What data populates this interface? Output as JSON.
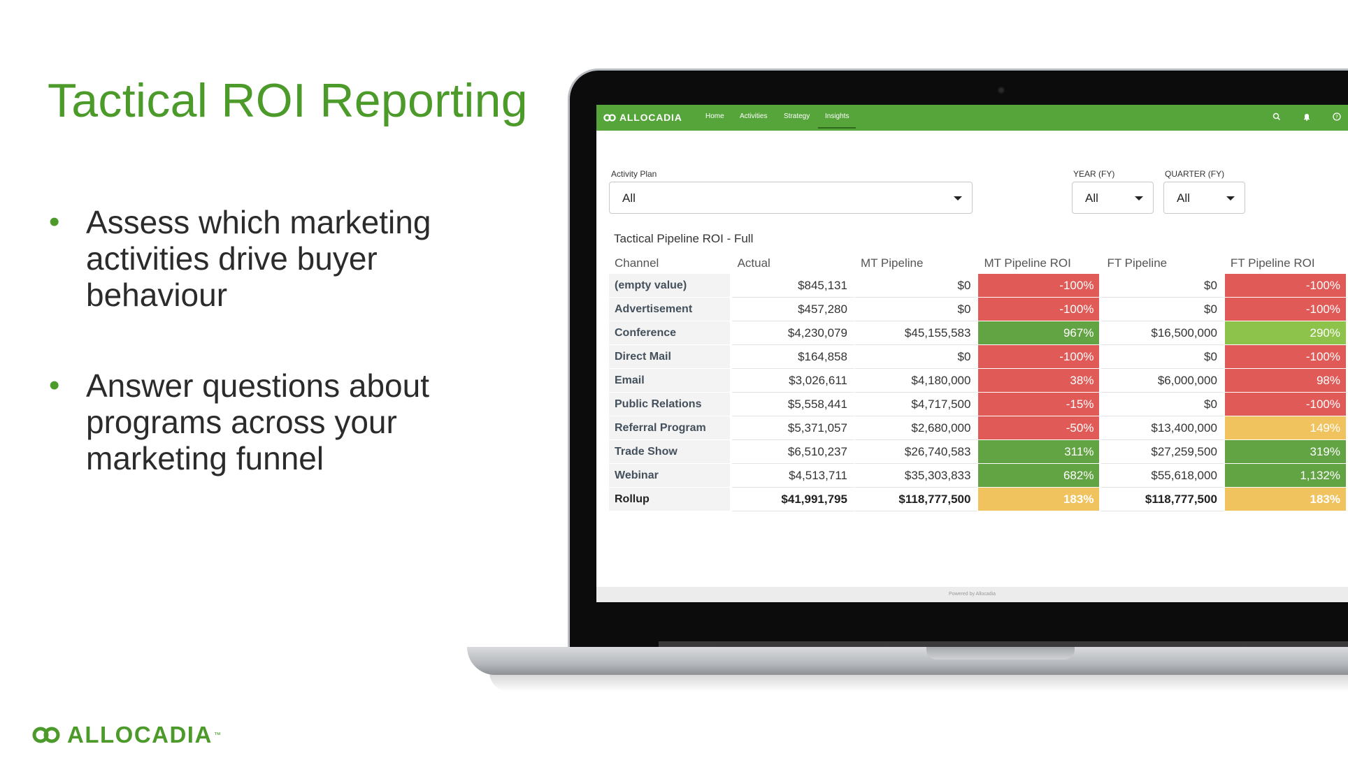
{
  "slide": {
    "title": "Tactical ROI Reporting",
    "bullets": [
      "Assess which marketing activities drive buyer behaviour",
      "Answer questions about programs across your marketing funnel"
    ],
    "footer_brand": "ALLOCADIA",
    "footer_tm": "™",
    "brand_color": "#4c9a2a"
  },
  "app": {
    "brand": "ALLOCADIA",
    "nav": [
      "Home",
      "Activities",
      "Strategy",
      "Insights"
    ],
    "active_nav": "Insights",
    "nav_color": "#56a53a",
    "icons": [
      "search-icon",
      "bell-icon",
      "help-icon"
    ],
    "filters": {
      "activity_plan": {
        "label": "Activity Plan",
        "value": "All"
      },
      "year": {
        "label": "YEAR (FY)",
        "value": "All"
      },
      "quarter": {
        "label": "QUARTER (FY)",
        "value": "All"
      }
    },
    "report": {
      "title": "Tactical Pipeline ROI - Full",
      "columns": [
        "Channel",
        "Actual",
        "MT Pipeline",
        "MT Pipeline ROI",
        "FT Pipeline",
        "FT Pipeline ROI"
      ],
      "rows": [
        {
          "channel": "(empty value)",
          "actual": "$845,131",
          "mt_pipeline": "$0",
          "mt_roi": "-100%",
          "mt_roi_color": "#e05b57",
          "ft_pipeline": "$0",
          "ft_roi": "-100%",
          "ft_roi_color": "#e05b57"
        },
        {
          "channel": "Advertisement",
          "actual": "$457,280",
          "mt_pipeline": "$0",
          "mt_roi": "-100%",
          "mt_roi_color": "#e05b57",
          "ft_pipeline": "$0",
          "ft_roi": "-100%",
          "ft_roi_color": "#e05b57"
        },
        {
          "channel": "Conference",
          "actual": "$4,230,079",
          "mt_pipeline": "$45,155,583",
          "mt_roi": "967%",
          "mt_roi_color": "#62a343",
          "ft_pipeline": "$16,500,000",
          "ft_roi": "290%",
          "ft_roi_color": "#8dc24b"
        },
        {
          "channel": "Direct Mail",
          "actual": "$164,858",
          "mt_pipeline": "$0",
          "mt_roi": "-100%",
          "mt_roi_color": "#e05b57",
          "ft_pipeline": "$0",
          "ft_roi": "-100%",
          "ft_roi_color": "#e05b57"
        },
        {
          "channel": "Email",
          "actual": "$3,026,611",
          "mt_pipeline": "$4,180,000",
          "mt_roi": "38%",
          "mt_roi_color": "#e05b57",
          "ft_pipeline": "$6,000,000",
          "ft_roi": "98%",
          "ft_roi_color": "#e05b57"
        },
        {
          "channel": "Public Relations",
          "actual": "$5,558,441",
          "mt_pipeline": "$4,717,500",
          "mt_roi": "-15%",
          "mt_roi_color": "#e05b57",
          "ft_pipeline": "$0",
          "ft_roi": "-100%",
          "ft_roi_color": "#e05b57"
        },
        {
          "channel": "Referral Program",
          "actual": "$5,371,057",
          "mt_pipeline": "$2,680,000",
          "mt_roi": "-50%",
          "mt_roi_color": "#e05b57",
          "ft_pipeline": "$13,400,000",
          "ft_roi": "149%",
          "ft_roi_color": "#f1c35f"
        },
        {
          "channel": "Trade Show",
          "actual": "$6,510,237",
          "mt_pipeline": "$26,740,583",
          "mt_roi": "311%",
          "mt_roi_color": "#62a343",
          "ft_pipeline": "$27,259,500",
          "ft_roi": "319%",
          "ft_roi_color": "#62a343"
        },
        {
          "channel": "Webinar",
          "actual": "$4,513,711",
          "mt_pipeline": "$35,303,833",
          "mt_roi": "682%",
          "mt_roi_color": "#62a343",
          "ft_pipeline": "$55,618,000",
          "ft_roi": "1,132%",
          "ft_roi_color": "#62a343"
        },
        {
          "channel": "Rollup",
          "actual": "$41,991,795",
          "mt_pipeline": "$118,777,500",
          "mt_roi": "183%",
          "mt_roi_color": "#f1c35f",
          "ft_pipeline": "$118,777,500",
          "ft_roi": "183%",
          "ft_roi_color": "#f1c35f"
        }
      ]
    },
    "footer": "Powered by Allocadia"
  }
}
